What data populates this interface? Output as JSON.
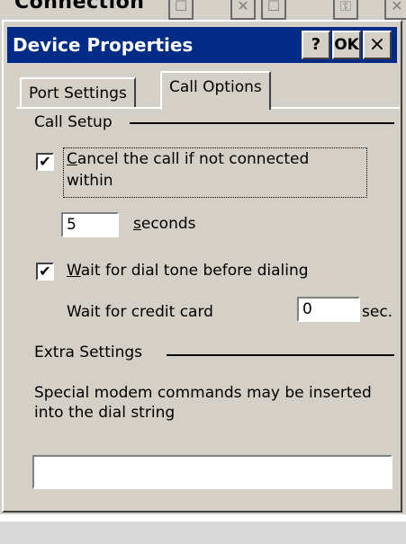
{
  "background_window": {
    "title": "Connection",
    "buttons": [
      "☐",
      "✕",
      "☐",
      "⚿",
      "✕"
    ]
  },
  "dialog": {
    "title": "Device Properties",
    "help_label": "?",
    "ok_label": "OK",
    "close_label": "×"
  },
  "tabs": [
    {
      "label": "Port Settings"
    },
    {
      "label": "Call Options"
    }
  ],
  "call_setup": {
    "group_label": "Call Setup",
    "cancel_prefix": "",
    "cancel_access": "C",
    "cancel_rest": "ancel the call if not connected",
    "cancel_line2": "within",
    "cancel_checked": true,
    "seconds_value": "5",
    "seconds_access": "s",
    "seconds_rest": "econds",
    "wait_access": "W",
    "wait_rest": "ait for dial tone before dialing",
    "wait_checked": true,
    "credit_label": "Wait for credit card",
    "credit_value": "0",
    "credit_unit": "sec."
  },
  "extra_settings": {
    "group_label": "Extra Settings",
    "description": "Special modem commands may be inserted into the dial string",
    "command_value": ""
  },
  "colors": {
    "titlebar": "#002c87",
    "face": "#d4d0c8"
  }
}
